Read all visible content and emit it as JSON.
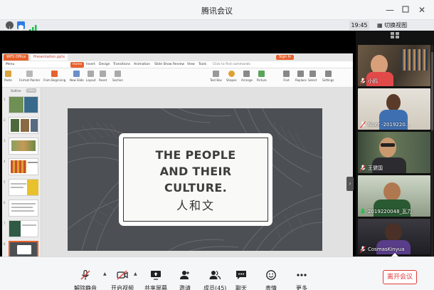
{
  "window": {
    "title": "腾讯会议",
    "controls": [
      "minimize-icon",
      "maximize-icon",
      "close-icon"
    ]
  },
  "infobar": {
    "time": "19:45",
    "switch_view_label": "切换视图",
    "colors": {
      "security": "#2f7be5",
      "signal": "#1fbf4a"
    }
  },
  "share": {
    "ppt": {
      "tabs": [
        "WPS Office",
        "Presentation.pptx"
      ],
      "menus": [
        "Menu",
        "Home",
        "Insert",
        "Design",
        "Transitions",
        "Animation",
        "Slide Show",
        "Review",
        "View",
        "Tools",
        "Click to find commands"
      ],
      "active_menu": "Home",
      "sign_in": "Sign In",
      "ribbon": [
        "Paste",
        "Format Painter",
        "From Beginning",
        "New Slide",
        "Layout",
        "Reset",
        "Section",
        "Text Box",
        "Shapes",
        "Arrange",
        "Picture",
        "Find",
        "Replace",
        "Select",
        "Settings"
      ],
      "panel_tabs": [
        "Outline",
        "Slides"
      ],
      "slide_numbers": [
        "1",
        "2",
        "3",
        "4",
        "5",
        "6",
        "7",
        "8"
      ],
      "notes_placeholder": "Click to add notes",
      "status_left": "Slide 8 / 8    Freedom",
      "zoom": "37%",
      "slide": {
        "title_lines": [
          "THE PEOPLE",
          "AND THEIR",
          "CULTURE."
        ],
        "subtitle_cn": "人和文"
      }
    }
  },
  "participants": {
    "header_icon": "grid-icon",
    "list": [
      {
        "name": "小鸥",
        "muted": true,
        "speaking": false
      },
      {
        "name": "Nuer -2019220...",
        "muted": true,
        "speaking": false
      },
      {
        "name": "王健国",
        "muted": true,
        "speaking": false
      },
      {
        "name": "2019220048_瓦力",
        "muted": false,
        "speaking": true
      },
      {
        "name": "CosmasKinyua",
        "muted": true,
        "speaking": false
      }
    ]
  },
  "toolbar": {
    "buttons": [
      {
        "id": "unmute",
        "label": "解除静音",
        "icon": "mic-off-icon"
      },
      {
        "id": "video",
        "label": "开启视频",
        "icon": "camera-off-icon"
      },
      {
        "id": "share",
        "label": "共享屏幕",
        "icon": "screen-share-icon"
      },
      {
        "id": "invite",
        "label": "邀请",
        "icon": "add-user-icon"
      },
      {
        "id": "members",
        "label": "成员(45)",
        "icon": "members-icon"
      },
      {
        "id": "chat",
        "label": "聊天",
        "icon": "chat-icon"
      },
      {
        "id": "emoji",
        "label": "表情",
        "icon": "smiley-icon"
      },
      {
        "id": "more",
        "label": "更多",
        "icon": "more-icon"
      }
    ],
    "leave_label": "离开会议",
    "leave_color": "#e43a3a"
  }
}
